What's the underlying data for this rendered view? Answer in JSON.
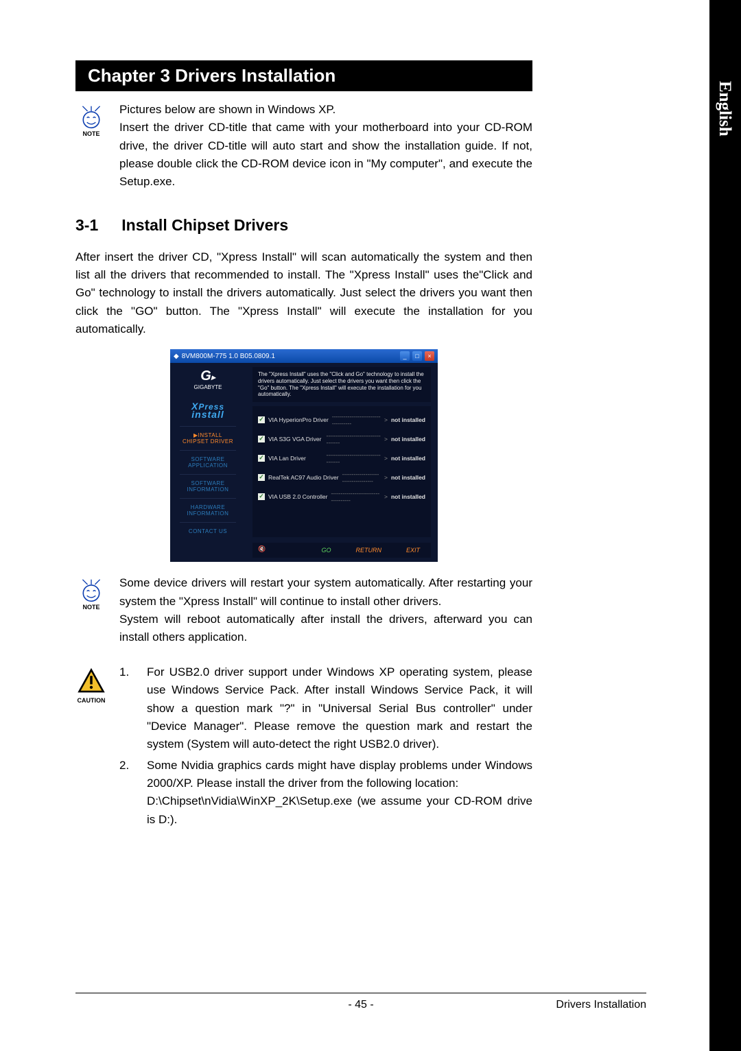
{
  "language": "English",
  "chapter_title": "Chapter 3 Drivers Installation",
  "note1": {
    "label": "NOTE",
    "text": "Pictures below are shown in Windows XP.\nInsert the driver CD-title that came with your motherboard into your CD-ROM drive, the driver CD-title will auto start and show the installation guide. If not, please double click the CD-ROM device icon in \"My computer\", and execute the Setup.exe."
  },
  "section": {
    "number": "3-1",
    "title": "Install Chipset Drivers"
  },
  "paragraph1": "After insert the driver CD, \"Xpress Install\" will  scan automatically the system and then list all the drivers that recommended to install. The \"Xpress Install\" uses the\"Click and Go\" technology to install the drivers automatically. Just select the drivers you want then click the \"GO\" button. The \"Xpress Install\" will execute the installation for you automatically.",
  "screenshot": {
    "title": "8VM800M-775 1.0 B05.0809.1",
    "brand": "GIGABYTE",
    "logo_text": "XPress\ninstall",
    "sidebar": [
      {
        "label": "▶INSTALL\nCHIPSET DRIVER",
        "active": true
      },
      {
        "label": "SOFTWARE\nAPPLICATION",
        "active": false
      },
      {
        "label": "SOFTWARE\nINFORMATION",
        "active": false
      },
      {
        "label": "HARDWARE\nINFORMATION",
        "active": false
      },
      {
        "label": "CONTACT US",
        "active": false
      }
    ],
    "intro": "The \"Xpress Install\" uses the \"Click and Go\" technology to install the drivers automatically. Just select the drivers you want then click the \"Go\" button. The \"Xpress Install\" will execute the installation for you automatically.",
    "drivers": [
      {
        "name": "VIA HyperionPro Driver",
        "status": "not installed"
      },
      {
        "name": "VIA S3G VGA Driver",
        "status": "not installed"
      },
      {
        "name": "VIA Lan Driver",
        "status": "not installed"
      },
      {
        "name": "RealTek AC97 Audio Driver",
        "status": "not installed"
      },
      {
        "name": "VIA USB 2.0 Controller",
        "status": "not installed"
      }
    ],
    "buttons": {
      "go": "GO",
      "return": "RETURN",
      "exit": "EXIT"
    }
  },
  "note2": {
    "label": "NOTE",
    "text": "Some device drivers will restart your system automatically. After restarting your system the \"Xpress Install\" will continue to install other drivers.\nSystem will reboot automatically after install the drivers, afterward you can install others application."
  },
  "caution": {
    "label": "CAUTION",
    "items": [
      {
        "num": "1.",
        "text": "For USB2.0 driver support under Windows XP operating system, please use Windows Service Pack. After install Windows Service Pack, it will show a question mark \"?\" in \"Universal Serial Bus controller\" under \"Device Manager\". Please remove the question mark and restart the system (System will auto-detect the right USB2.0 driver)."
      },
      {
        "num": "2.",
        "text": "Some Nvidia graphics cards might have display problems under Windows 2000/XP. Please install the driver from the following location:\nD:\\Chipset\\nVidia\\WinXP_2K\\Setup.exe (we assume your CD-ROM drive is D:)."
      }
    ]
  },
  "footer": {
    "page": "- 45 -",
    "section": "Drivers Installation"
  }
}
